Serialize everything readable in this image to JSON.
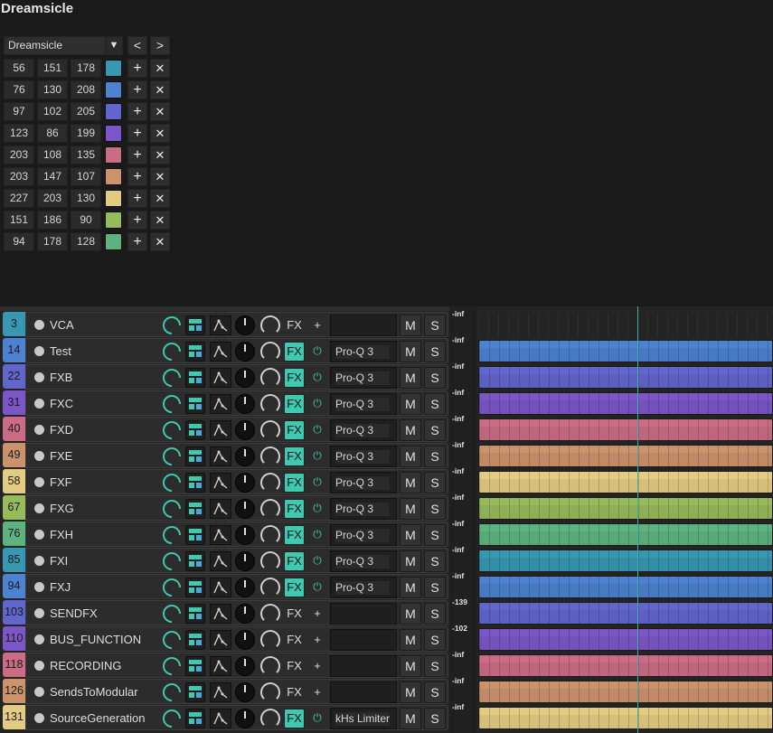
{
  "window_title": "Dreamsicle",
  "palette": {
    "name": "Dreamsicle",
    "dropdown_icon": "caret-down-icon",
    "prev_label": "<",
    "next_label": ">",
    "add_label": "+",
    "remove_label": "✕",
    "colors": [
      {
        "r": "56",
        "g": "151",
        "b": "178",
        "hex": "#3897b2"
      },
      {
        "r": "76",
        "g": "130",
        "b": "208",
        "hex": "#4c82d0"
      },
      {
        "r": "97",
        "g": "102",
        "b": "205",
        "hex": "#6166cd"
      },
      {
        "r": "123",
        "g": "86",
        "b": "199",
        "hex": "#7b56c7"
      },
      {
        "r": "203",
        "g": "108",
        "b": "135",
        "hex": "#cb6c87"
      },
      {
        "r": "203",
        "g": "147",
        "b": "107",
        "hex": "#cb936b"
      },
      {
        "r": "227",
        "g": "203",
        "b": "130",
        "hex": "#e3cb82"
      },
      {
        "r": "151",
        "g": "186",
        "b": "90",
        "hex": "#97ba5a"
      },
      {
        "r": "94",
        "g": "178",
        "b": "128",
        "hex": "#5eb280"
      }
    ]
  },
  "tracks": [
    {
      "num": "3",
      "name": "VCA",
      "color": "#3897b2",
      "fx_on": false,
      "fx_aux": "+",
      "fx_slot": "",
      "peak": "-inf",
      "item": false
    },
    {
      "num": "14",
      "name": "Test",
      "color": "#4c82d0",
      "fx_on": true,
      "fx_aux": "⏻",
      "fx_slot": "Pro-Q 3",
      "peak": "-inf",
      "item": true
    },
    {
      "num": "22",
      "name": "FXB",
      "color": "#6166cd",
      "fx_on": true,
      "fx_aux": "⏻",
      "fx_slot": "Pro-Q 3",
      "peak": "-inf",
      "item": true
    },
    {
      "num": "31",
      "name": "FXC",
      "color": "#7b56c7",
      "fx_on": true,
      "fx_aux": "⏻",
      "fx_slot": "Pro-Q 3",
      "peak": "-inf",
      "item": true
    },
    {
      "num": "40",
      "name": "FXD",
      "color": "#cb6c87",
      "fx_on": true,
      "fx_aux": "⏻",
      "fx_slot": "Pro-Q 3",
      "peak": "-inf",
      "item": true
    },
    {
      "num": "49",
      "name": "FXE",
      "color": "#cb936b",
      "fx_on": true,
      "fx_aux": "⏻",
      "fx_slot": "Pro-Q 3",
      "peak": "-inf",
      "item": true
    },
    {
      "num": "58",
      "name": "FXF",
      "color": "#e3cb82",
      "fx_on": true,
      "fx_aux": "⏻",
      "fx_slot": "Pro-Q 3",
      "peak": "-inf",
      "item": true
    },
    {
      "num": "67",
      "name": "FXG",
      "color": "#97ba5a",
      "fx_on": true,
      "fx_aux": "⏻",
      "fx_slot": "Pro-Q 3",
      "peak": "-inf",
      "item": true
    },
    {
      "num": "76",
      "name": "FXH",
      "color": "#5eb280",
      "fx_on": true,
      "fx_aux": "⏻",
      "fx_slot": "Pro-Q 3",
      "peak": "-inf",
      "item": true
    },
    {
      "num": "85",
      "name": "FXI",
      "color": "#3897b2",
      "fx_on": true,
      "fx_aux": "⏻",
      "fx_slot": "Pro-Q 3",
      "peak": "-inf",
      "item": true
    },
    {
      "num": "94",
      "name": "FXJ",
      "color": "#4c82d0",
      "fx_on": true,
      "fx_aux": "⏻",
      "fx_slot": "Pro-Q 3",
      "peak": "-inf",
      "item": true
    },
    {
      "num": "103",
      "name": "SENDFX",
      "color": "#6166cd",
      "fx_on": false,
      "fx_aux": "+",
      "fx_slot": "",
      "peak": "-139",
      "item": true
    },
    {
      "num": "110",
      "name": "BUS_FUNCTION",
      "color": "#7b56c7",
      "fx_on": false,
      "fx_aux": "+",
      "fx_slot": "",
      "peak": "-102",
      "item": true
    },
    {
      "num": "118",
      "name": "RECORDING",
      "color": "#cb6c87",
      "fx_on": false,
      "fx_aux": "+",
      "fx_slot": "",
      "peak": "-inf",
      "item": true
    },
    {
      "num": "126",
      "name": "SendsToModular",
      "color": "#cb936b",
      "fx_on": false,
      "fx_aux": "+",
      "fx_slot": "",
      "peak": "-inf",
      "item": true
    },
    {
      "num": "131",
      "name": "SourceGeneration",
      "color": "#e3cb82",
      "fx_on": true,
      "fx_aux": "⏻",
      "fx_slot": "kHs Limiter",
      "peak": "-inf",
      "item": true
    }
  ],
  "track_labels": {
    "fx": "FX",
    "mute": "M",
    "solo": "S"
  }
}
